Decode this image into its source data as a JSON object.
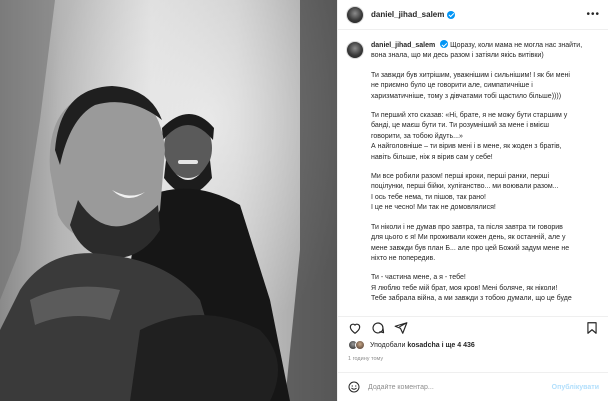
{
  "post": {
    "username": "daniel_jihad_salem",
    "caption_head": "Щоразу, коли мама не могла нас знайти, вона знала, що ми десь разом і затіяли якісь витівки)",
    "paragraphs": [
      [
        "Ти завжди був хитрішим, уважнішим і сильнішим! І як би мені",
        "не приємно було це говорити але, симпатичніше і",
        "харизматичніше, тому з дівчатами тобі щастило більше))))"
      ],
      [
        "Ти перший хто сказав: «Ні, брате, я не можу бути старшим у",
        "банді, це маєш бути ти. Ти розумніший за мене і вмієш",
        "говорити, за тобою йдуть...»",
        "А найголовніше – ти вірив мені і в мене, як жоден з братів,",
        "навіть більше, ніж я вірив сам у себе!"
      ],
      [
        "Ми все робили разом! перші кроки, перші ранки, перші",
        "поцілунки, перші бійки, хуліганство... ми воювали разом...",
        "І ось тебе нема, ти пішов, так рано!",
        "І це не чесно! Ми так не домовлялися!"
      ],
      [
        "Ти ніколи і не думав про завтра, та після завтра ти говорив",
        "для цього є я! Ми проживали кожен день, як останній, але у",
        "мене завжди був план Б... але про цей Божий задум мене не",
        "ніхто не попередив."
      ],
      [
        "Ти - частина мене, а я - тебе!",
        "Я люблю тебе мій брат, моя кров! Мені боляче, як ніколи!",
        "Тебе забрала війна, а ми завжди з тобою думали, що це буде"
      ]
    ]
  },
  "likes": {
    "prefix": "Уподобали",
    "user": "kosadcha",
    "suffix": "і ще 4 436"
  },
  "time_ago": "1 годину тому",
  "comment": {
    "placeholder": "Додайте коментар...",
    "publish_label": "Опублікувати"
  },
  "icons": {
    "like": "heart-icon",
    "comment": "comment-icon",
    "share": "share-icon",
    "save": "bookmark-icon",
    "emoji": "emoji-icon",
    "more": "more-icon"
  },
  "colors": {
    "verified": "#0095f6",
    "publish_disabled": "#b2dffc",
    "muted": "#8e8e8e"
  }
}
